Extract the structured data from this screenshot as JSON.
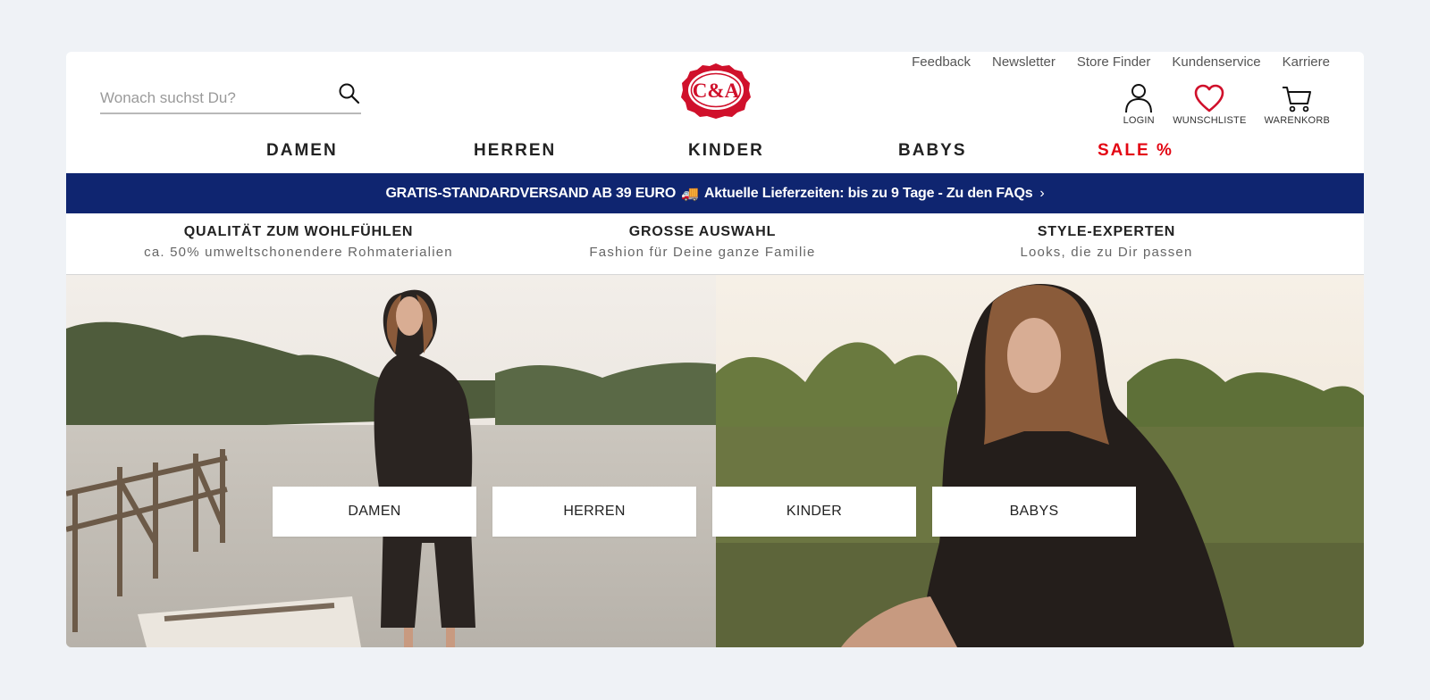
{
  "search": {
    "placeholder": "Wonach suchst Du?"
  },
  "logo": {
    "text": "C&A",
    "color": "#d0102b"
  },
  "service_links": [
    "Feedback",
    "Newsletter",
    "Store Finder",
    "Kundenservice",
    "Karriere"
  ],
  "actions": {
    "login": "LOGIN",
    "wishlist": "WUNSCHLISTE",
    "cart": "WARENKORB"
  },
  "main_nav": [
    "DAMEN",
    "HERREN",
    "KINDER",
    "BABYS",
    "SALE %"
  ],
  "sale_color": "#e30613",
  "banner": {
    "text_a": "GRATIS-STANDARDVERSAND AB 39 EURO",
    "truck": "🚚",
    "text_b": "Aktuelle Lieferzeiten: bis zu 9 Tage - Zu den FAQs",
    "chevron": "›",
    "background": "#0f2570"
  },
  "usps": [
    {
      "title": "QUALITÄT ZUM WOHLFÜHLEN",
      "subtitle": "ca. 50% umweltschonendere Rohmaterialien"
    },
    {
      "title": "GROSSE AUSWAHL",
      "subtitle": "Fashion für Deine ganze Familie"
    },
    {
      "title": "STYLE-EXPERTEN",
      "subtitle": "Looks, die zu Dir passen"
    }
  ],
  "hero_buttons": [
    "DAMEN",
    "HERREN",
    "KINDER",
    "BABYS"
  ]
}
